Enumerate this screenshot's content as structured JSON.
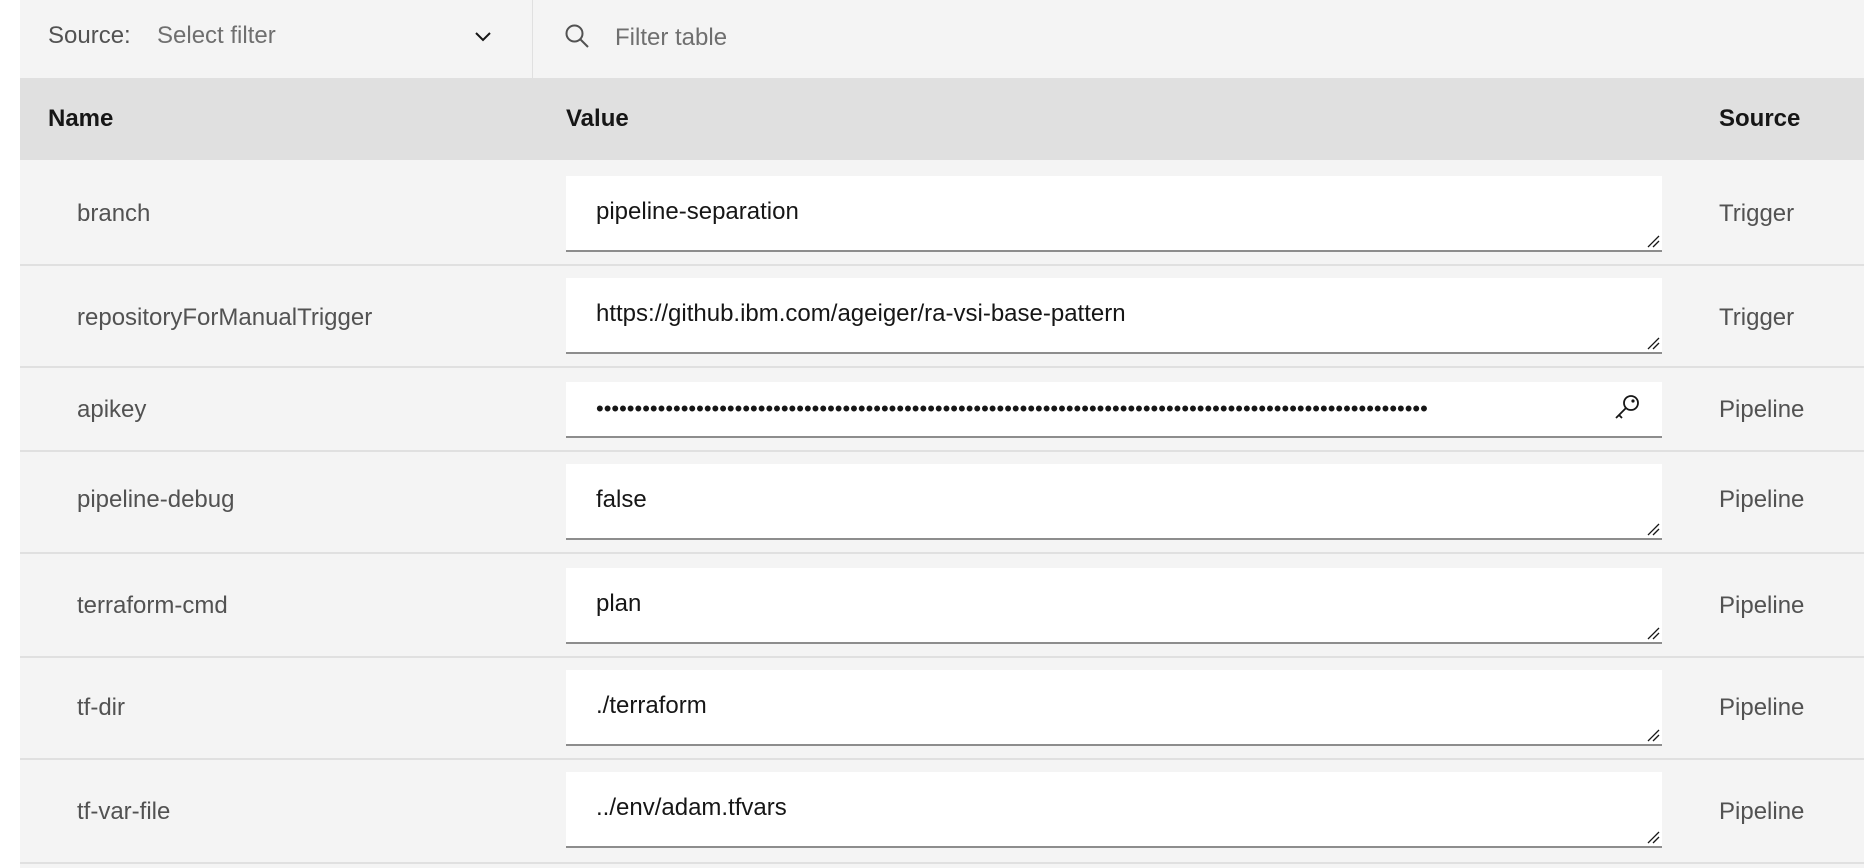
{
  "toolbar": {
    "source_label": "Source:",
    "source_placeholder": "Select filter",
    "search_placeholder": "Filter table"
  },
  "table": {
    "headers": {
      "name": "Name",
      "value": "Value",
      "source": "Source"
    },
    "rows": [
      {
        "name": "branch",
        "value": "pipeline-separation",
        "source": "Trigger",
        "secure": false
      },
      {
        "name": "repositoryForManualTrigger",
        "value": "https://github.ibm.com/ageiger/ra-vsi-base-pattern",
        "source": "Trigger",
        "secure": false
      },
      {
        "name": "apikey",
        "value": "••••••••••••••••••••••••••••••••••••••••••••••••••••••••••••••••••••••••••••••••••••••••••••••••••••••••••••",
        "source": "Pipeline",
        "secure": true
      },
      {
        "name": "pipeline-debug",
        "value": "false",
        "source": "Pipeline",
        "secure": false
      },
      {
        "name": "terraform-cmd",
        "value": "plan",
        "source": "Pipeline",
        "secure": false
      },
      {
        "name": "tf-dir",
        "value": "./terraform",
        "source": "Pipeline",
        "secure": false
      },
      {
        "name": "tf-var-file",
        "value": "../env/adam.tfvars",
        "source": "Pipeline",
        "secure": false
      }
    ]
  },
  "icons": {
    "dropdown": "chevron-down-icon",
    "search": "search-icon",
    "secure_value": "key-icon",
    "textarea_resize": "resize-handle-icon"
  },
  "colors": {
    "panel_bg": "#f4f4f4",
    "header_bg": "#e0e0e0",
    "input_bg": "#ffffff",
    "text_primary": "#161616",
    "text_secondary": "#525252",
    "placeholder": "#6f6f6f"
  }
}
